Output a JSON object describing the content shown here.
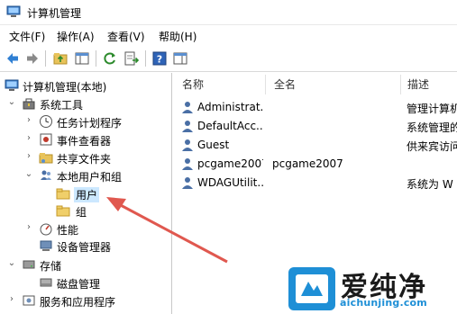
{
  "window": {
    "title": "计算机管理"
  },
  "menu": [
    "文件(F)",
    "操作(A)",
    "查看(V)",
    "帮助(H)"
  ],
  "toolbar_icons": [
    "back-arrow-icon",
    "forward-arrow-icon",
    "up-folder-icon",
    "show-hide-tree-icon",
    "refresh-icon",
    "export-list-icon",
    "help-icon",
    "properties-pane-icon"
  ],
  "tree": {
    "root": "计算机管理(本地)",
    "system_tools": "系统工具",
    "task_scheduler": "任务计划程序",
    "event_viewer": "事件查看器",
    "shared_folders": "共享文件夹",
    "local_users_groups": "本地用户和组",
    "users": "用户",
    "groups": "组",
    "performance": "性能",
    "device_manager": "设备管理器",
    "storage": "存储",
    "disk_management": "磁盘管理",
    "services_apps": "服务和应用程序"
  },
  "columns": {
    "name": "名称",
    "fullname": "全名",
    "description": "描述"
  },
  "users": [
    {
      "name": "Administrat...",
      "fullname": "",
      "description": "管理计算机"
    },
    {
      "name": "DefaultAcc...",
      "fullname": "",
      "description": "系统管理的"
    },
    {
      "name": "Guest",
      "fullname": "",
      "description": "供来宾访问"
    },
    {
      "name": "pcgame2007",
      "fullname": "pcgame2007",
      "description": ""
    },
    {
      "name": "WDAGUtilit...",
      "fullname": "",
      "description": "系统为 W"
    }
  ],
  "watermark": {
    "cn": "爱纯净",
    "url": "aichunjing.com"
  },
  "colors": {
    "selection": "#cce8ff",
    "arrow": "#e0584f",
    "watermark_blue": "#1e8fd6"
  }
}
